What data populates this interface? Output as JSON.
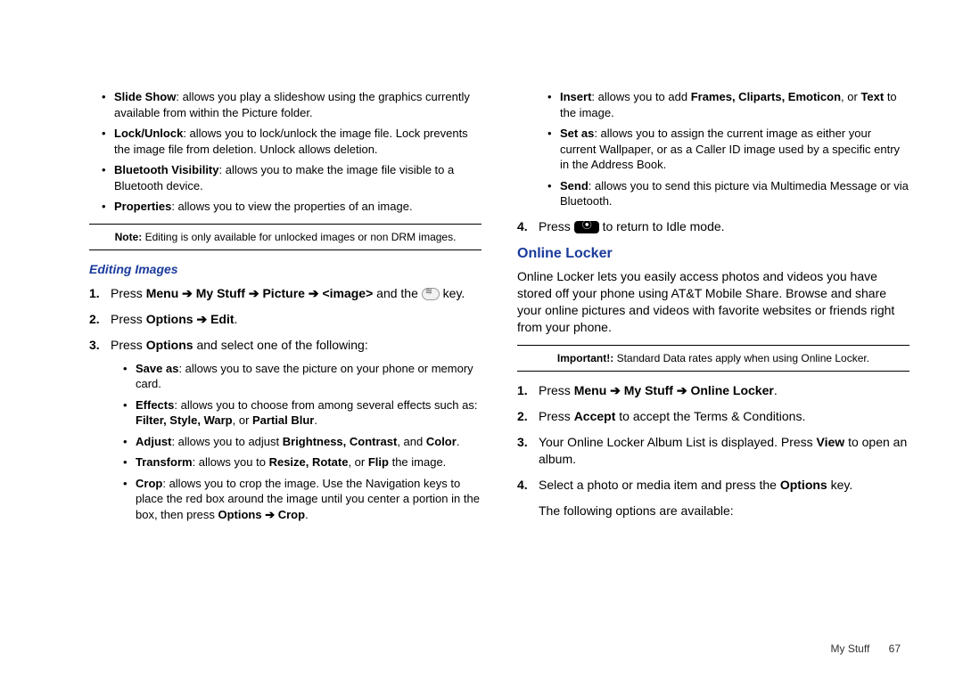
{
  "left": {
    "top_bullets": [
      {
        "term": "Slide Show",
        "desc": ": allows you play a slideshow using the graphics currently available from within the Picture folder."
      },
      {
        "term": "Lock/Unlock",
        "desc": ": allows you to lock/unlock the image file. Lock prevents the image file from deletion. Unlock allows deletion."
      },
      {
        "term": "Bluetooth Visibility",
        "desc": ": allows you to make the image file visible to a Bluetooth device."
      },
      {
        "term": "Properties",
        "desc": ": allows you to view the properties of an image."
      }
    ],
    "note_label": "Note:",
    "note_text": " Editing is only available for unlocked images or non DRM images.",
    "sub_heading": "Editing Images",
    "step1_a": "Press ",
    "step1_b": "Menu ➔ My Stuff ➔ Picture ➔ <image>",
    "step1_c": " and the ",
    "step1_d": " key.",
    "step2_a": "Press ",
    "step2_b": "Options ➔ Edit",
    "step2_c": ".",
    "step3_a": "Press ",
    "step3_b": "Options",
    "step3_c": " and select one of the following:",
    "edit_bullets": [
      {
        "term": "Save as",
        "desc": ": allows you to save the picture on your phone or memory card."
      },
      {
        "term": "Effects",
        "desc": ": allows you to choose from among several effects such as: ",
        "tail": "Filter, Style, Warp",
        "tail2": ", or ",
        "tail3": "Partial Blur",
        "tail4": "."
      },
      {
        "term": "Adjust",
        "desc": ": allows you to adjust ",
        "tail": "Brightness, Contrast",
        "tail2": ", and ",
        "tail3": "Color",
        "tail4": "."
      },
      {
        "term": "Transform",
        "desc": ": allows you to ",
        "tail": "Resize, Rotate",
        "tail2": ", or ",
        "tail3": "Flip",
        "tail4": " the image."
      },
      {
        "term": "Crop",
        "desc": ": allows you to crop the image. Use the Navigation keys to place the red box around the image until you center a portion in the box, then press ",
        "tail": "Options ➔ Crop",
        "tail4": "."
      }
    ]
  },
  "right": {
    "top_bullets": [
      {
        "term": "Insert",
        "desc": ": allows you to add ",
        "tail": "Frames, Cliparts, Emoticon",
        "tail2": ", or ",
        "tail3": "Text",
        "tail4": " to the image."
      },
      {
        "term": "Set as",
        "desc": ": allows you to assign the current image as either your current Wallpaper, or as a Caller ID image used by a specific entry in the Address Book."
      },
      {
        "term": "Send",
        "desc": ": allows you to send this picture via Multimedia Message or via Bluetooth."
      }
    ],
    "step4_a": "Press ",
    "step4_b": " to return to Idle mode.",
    "heading": "Online Locker",
    "intro": "Online Locker lets you easily access photos and videos you have stored off your phone using AT&T Mobile Share. Browse and share your online pictures and videos with favorite websites or friends right from your phone.",
    "imp_label": "Important!:",
    "imp_text": " Standard Data rates apply when using Online Locker.",
    "s1_a": "Press ",
    "s1_b": "Menu ➔ My Stuff ➔ Online Locker",
    "s1_c": ".",
    "s2_a": "Press ",
    "s2_b": "Accept",
    "s2_c": " to accept the Terms & Conditions.",
    "s3_a": "Your Online Locker Album List is displayed. Press ",
    "s3_b": "View",
    "s3_c": " to open an album.",
    "s4_a": "Select a photo or media item and press the ",
    "s4_b": "Options",
    "s4_c": " key.",
    "s_after": "The following options are available:"
  },
  "footer": {
    "section": "My Stuff",
    "page": "67"
  }
}
